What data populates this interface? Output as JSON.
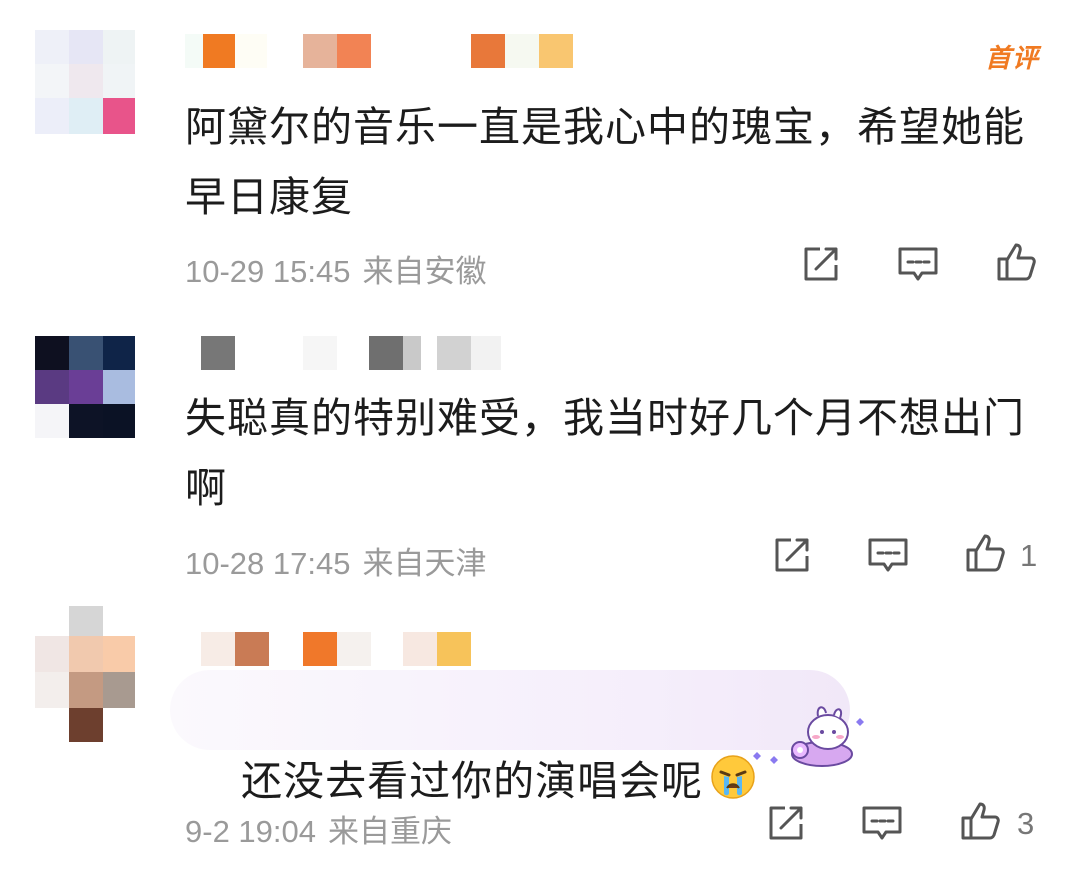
{
  "comments": [
    {
      "text": "阿黛尔的音乐一直是我心中的瑰宝，希望她能早日康复",
      "time": "10-29 15:45",
      "location": "来自安徽",
      "badge": "首评",
      "likes": ""
    },
    {
      "text": "失聪真的特别难受，我当时好几个月不想出门啊",
      "time": "10-28 17:45",
      "location": "来自天津",
      "likes": "1"
    },
    {
      "text": "还没去看过你的演唱会呢",
      "time": "9-2 19:04",
      "location": "来自重庆",
      "likes": "3"
    }
  ],
  "icons": {
    "share": "share-icon",
    "reply": "comment-icon",
    "like": "thumbs-up-icon",
    "emoji": "crying-face-icon"
  },
  "colors": {
    "badge": "#f07a22",
    "meta_text": "#9a9a9a",
    "icon_stroke": "#555555"
  }
}
